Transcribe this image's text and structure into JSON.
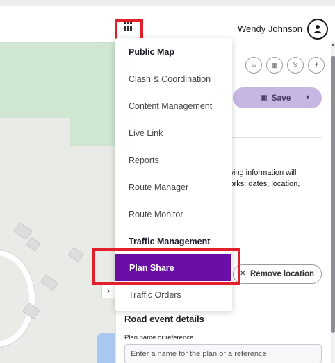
{
  "header": {
    "user_name": "Wendy Johnson",
    "apps_icon": "grid-icon",
    "avatar_icon": "user-icon"
  },
  "menu": {
    "items": [
      {
        "label": "Public Map",
        "bold": true
      },
      {
        "label": "Clash & Coordination",
        "bold": false
      },
      {
        "label": "Content Management",
        "bold": false
      },
      {
        "label": "Live Link",
        "bold": false
      },
      {
        "label": "Reports",
        "bold": false
      },
      {
        "label": "Route Manager",
        "bold": false
      },
      {
        "label": "Route Monitor",
        "bold": false
      },
      {
        "label": "Traffic Management",
        "bold": true
      },
      {
        "label": "Plan Share",
        "bold": true,
        "active": true
      },
      {
        "label": "Traffic Orders",
        "bold": false
      }
    ]
  },
  "panel": {
    "share_icons": [
      "link-icon",
      "qr-code-icon",
      "x-icon",
      "facebook-icon"
    ],
    "save_label": "Save",
    "info_line1": "llowing information will",
    "info_line2": "l works: dates, location,",
    "remove_location_label": "Remove location",
    "section_title": "Road event details",
    "plan_name_label": "Plan name or reference",
    "plan_name_placeholder": "Enter a name for the plan or a reference"
  },
  "colors": {
    "accent_purple": "#6a0fa6",
    "save_button_bg": "#c7b6e3",
    "highlight_red": "#e0202a"
  }
}
